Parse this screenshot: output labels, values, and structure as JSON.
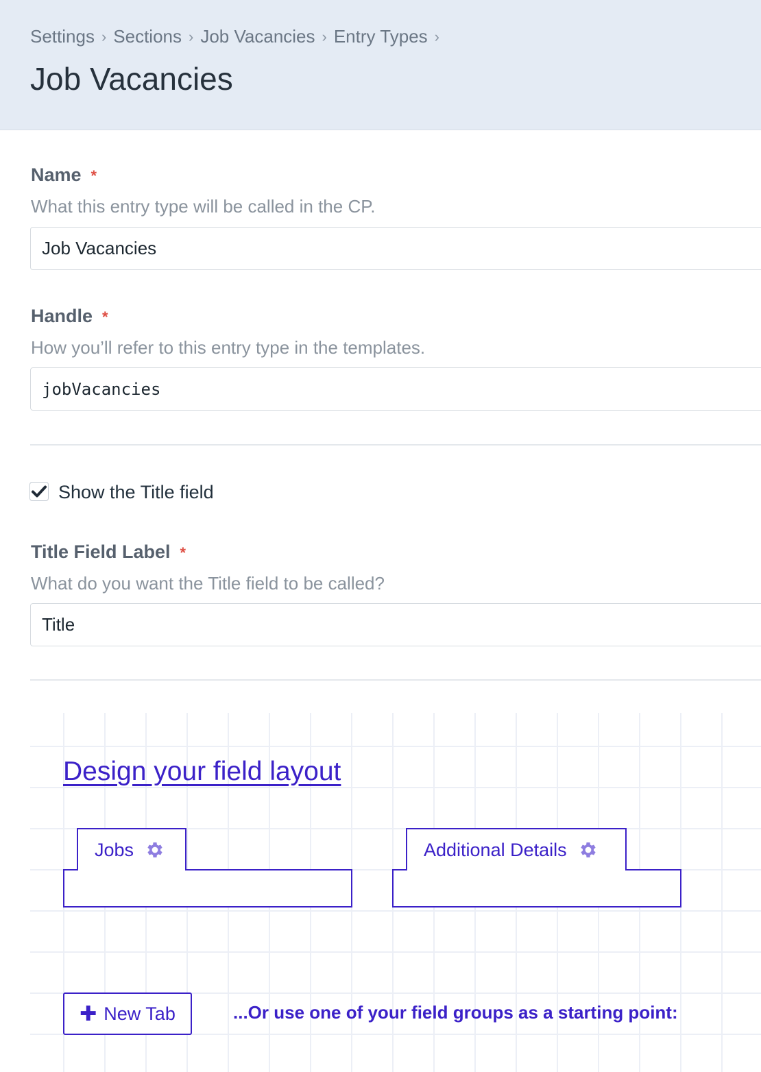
{
  "breadcrumb": {
    "items": [
      "Settings",
      "Sections",
      "Job Vacancies",
      "Entry Types"
    ]
  },
  "page": {
    "title": "Job Vacancies"
  },
  "fields": {
    "name": {
      "label": "Name",
      "required_mark": "*",
      "instructions": "What this entry type will be called in the CP.",
      "value": "Job Vacancies"
    },
    "handle": {
      "label": "Handle",
      "required_mark": "*",
      "instructions": "How you’ll refer to this entry type in the templates.",
      "value": "jobVacancies"
    },
    "show_title": {
      "label": "Show the Title field",
      "checked": true
    },
    "title_label": {
      "label": "Title Field Label",
      "required_mark": "*",
      "instructions": "What do you want the Title field to be called?",
      "value": "Title"
    }
  },
  "layout_designer": {
    "link": "Design your field layout",
    "tabs": [
      {
        "name": "Jobs",
        "icon": "gear-icon"
      },
      {
        "name": "Additional Details",
        "icon": "gear-icon"
      }
    ],
    "new_tab_button": "New Tab",
    "new_tab_icon": "plus-icon",
    "field_groups_prompt": "...Or use one of your field groups as a starting point:"
  },
  "colors": {
    "accent": "#3b21c8",
    "required": "#de4e43",
    "header_bg": "#e4ebf4"
  }
}
